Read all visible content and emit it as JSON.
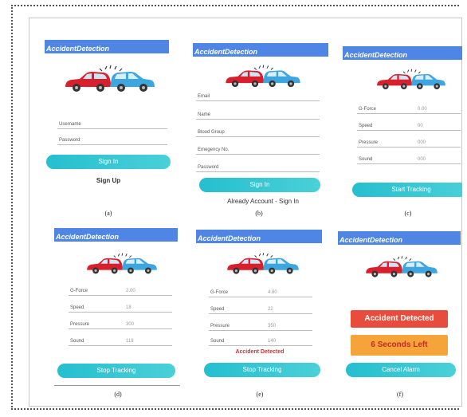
{
  "app_title": "AccidentDetection",
  "panel_a": {
    "username": "Username",
    "password": "Password",
    "sign_in": "Sign In",
    "sign_up": "Sign Up",
    "caption": "(a)"
  },
  "panel_b": {
    "email": "Email",
    "name": "Name",
    "blood_group": "Blood Group",
    "emergency_no": "Emegency No.",
    "password": "Password",
    "sign_in": "Sign In",
    "already": "Already Account - Sign In",
    "caption": "(b)"
  },
  "panel_c": {
    "gforce": "G-Force",
    "gforce_val": "0.00",
    "speed": "Speed",
    "speed_val": "00",
    "pressure": "Pressure",
    "pressure_val": "000",
    "sound": "Sound",
    "sound_val": "000",
    "start": "Start Tracking",
    "caption": "(c)"
  },
  "panel_d": {
    "gforce": "G-Force",
    "gforce_val": "2.00",
    "speed": "Speed",
    "speed_val": "18",
    "pressure": "Pressure",
    "pressure_val": "300",
    "sound": "Sound",
    "sound_val": "118",
    "stop": "Stop Tracking",
    "caption": "(d)"
  },
  "panel_e": {
    "gforce": "G-Force",
    "gforce_val": "4.80",
    "speed": "Speed",
    "speed_val": "22",
    "pressure": "Pressure",
    "pressure_val": "350",
    "sound": "Sound",
    "sound_val": "140",
    "detected": "Accident Detected",
    "stop": "Stop Tracking",
    "caption": "(e)"
  },
  "panel_f": {
    "detected": "Accident Detected",
    "seconds_left": "6 Seconds Left",
    "cancel": "Cancel Alarm",
    "caption": "(f)"
  },
  "colors": {
    "titlebar": "#4f86e6",
    "button": "#25bfcf",
    "alert_red": "#e74c3c",
    "alert_orange": "#f5a43a"
  }
}
